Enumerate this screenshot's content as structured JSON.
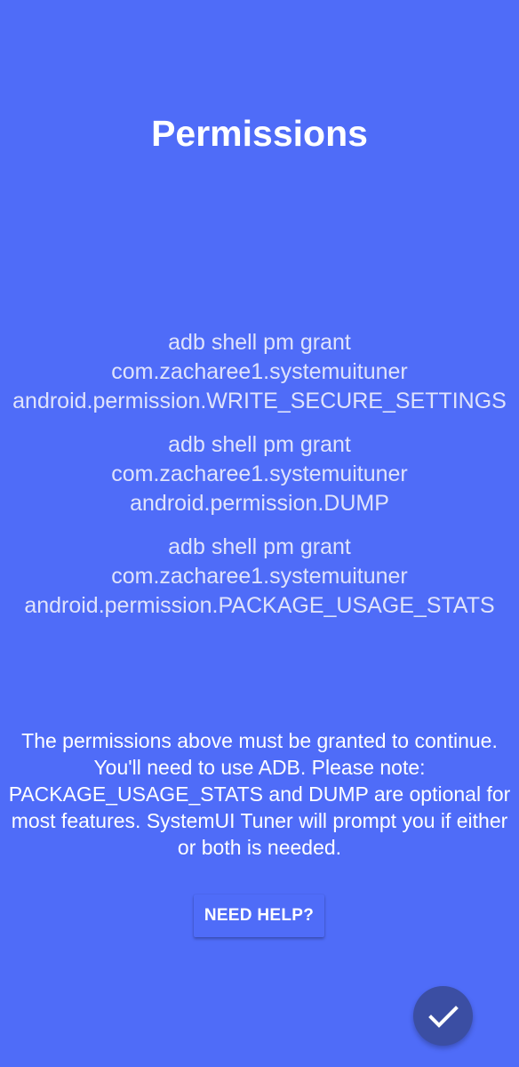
{
  "screen": {
    "title": "Permissions"
  },
  "commands": [
    {
      "line1": "adb shell pm grant",
      "line2": "com.zacharee1.systemuituner",
      "line3": "android.permission.WRITE_SECURE_SETTINGS"
    },
    {
      "line1": "adb shell pm grant",
      "line2": "com.zacharee1.systemuituner",
      "line3": "android.permission.DUMP"
    },
    {
      "line1": "adb shell pm grant",
      "line2": "com.zacharee1.systemuituner",
      "line3": "android.permission.PACKAGE_USAGE_STATS"
    }
  ],
  "note": "The permissions above must be granted to continue. You'll need to use ADB. Please note: PACKAGE_USAGE_STATS and DUMP are optional for most features. SystemUI Tuner will prompt you if either or both is needed.",
  "help_button": {
    "label": "NEED HELP?"
  },
  "fab": {
    "icon": "check-icon"
  },
  "colors": {
    "background": "#4f6cf8",
    "fab": "#3b4ea3",
    "command_text": "#dfe3fb"
  }
}
